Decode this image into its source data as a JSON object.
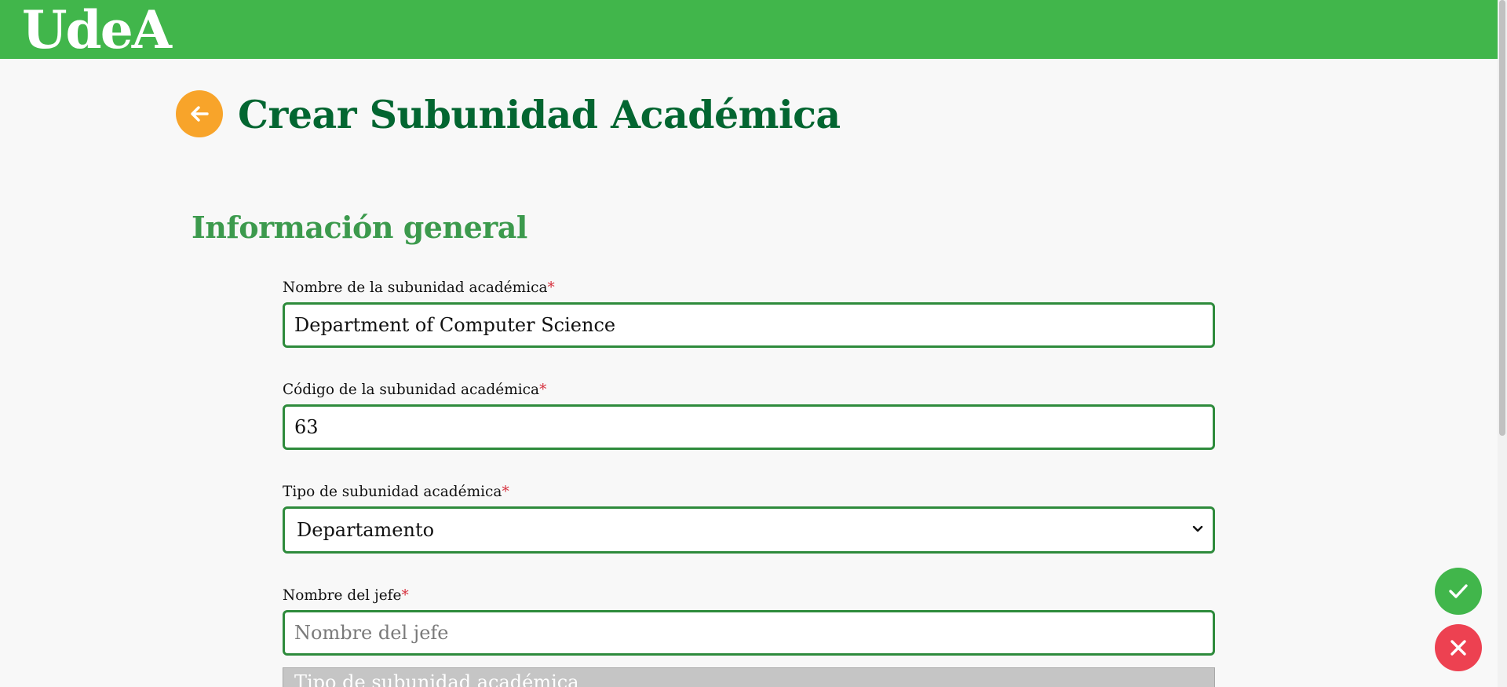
{
  "header": {
    "logo_text": "UdeA",
    "brand_color": "#41b64b"
  },
  "page": {
    "title": "Crear Subunidad Académica",
    "back_icon": "arrow-left-icon"
  },
  "section": {
    "title": "Información general"
  },
  "form": {
    "required_marker": "*",
    "nombre": {
      "label": "Nombre de la subunidad académica",
      "value": "Department of Computer Science"
    },
    "codigo": {
      "label": "Código de la subunidad académica",
      "value": "63"
    },
    "tipo": {
      "label": "Tipo de subunidad académica",
      "selected": "Departamento"
    },
    "jefe": {
      "label": "Nombre del jefe",
      "value": "",
      "placeholder": "Nombre del jefe"
    },
    "tipo_disabled": {
      "text": "Tipo de subunidad académica"
    }
  },
  "actions": {
    "confirm_icon": "checkmark-icon",
    "cancel_icon": "close-icon",
    "confirm_color": "#41b64b",
    "cancel_color": "#ed4151"
  }
}
